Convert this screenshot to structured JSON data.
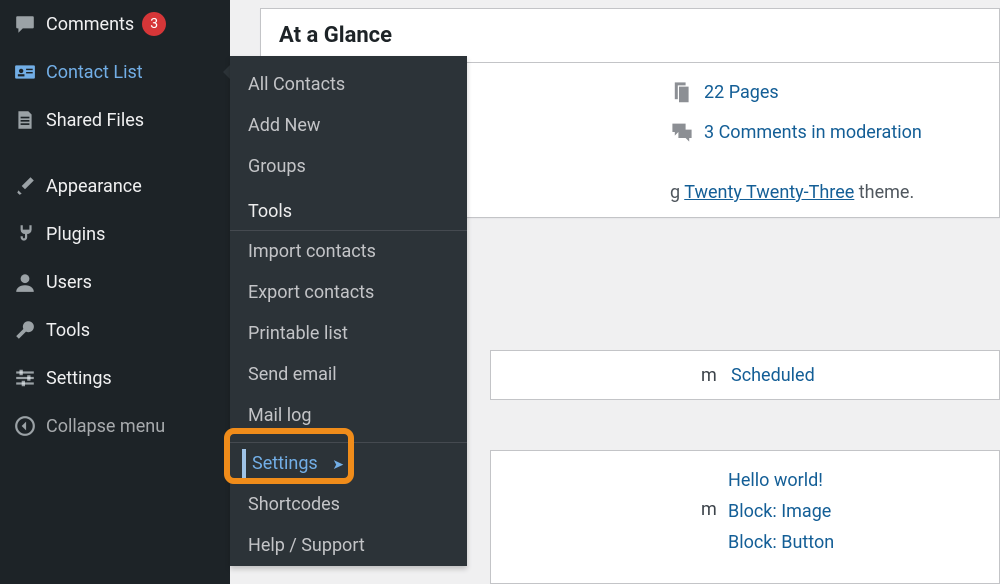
{
  "sidebar": {
    "items": [
      {
        "label": "Comments",
        "badge": "3"
      },
      {
        "label": "Contact List"
      },
      {
        "label": "Shared Files"
      },
      {
        "label": "Appearance"
      },
      {
        "label": "Plugins"
      },
      {
        "label": "Users"
      },
      {
        "label": "Tools"
      },
      {
        "label": "Settings"
      },
      {
        "label": "Collapse menu"
      }
    ]
  },
  "submenu": {
    "items_top": [
      "All Contacts",
      "Add New",
      "Groups"
    ],
    "header": "Tools",
    "items_tools": [
      "Import contacts",
      "Export contacts",
      "Printable list",
      "Send email",
      "Mail log"
    ],
    "items_bottom": [
      "Settings",
      "Shortcodes",
      "Help / Support"
    ]
  },
  "card": {
    "title": "At a Glance",
    "glance": [
      {
        "label": "22 Pages"
      },
      {
        "label": "3 Comments in moderation"
      }
    ],
    "theme_prefix": "g ",
    "theme_link": "Twenty Twenty-Three",
    "theme_suffix": " theme."
  },
  "rows": {
    "row1_m": "m",
    "row1_link": "Scheduled",
    "row2_m": "m",
    "row2_links": [
      "Hello world!",
      "Block: Image",
      "Block: Button"
    ]
  }
}
